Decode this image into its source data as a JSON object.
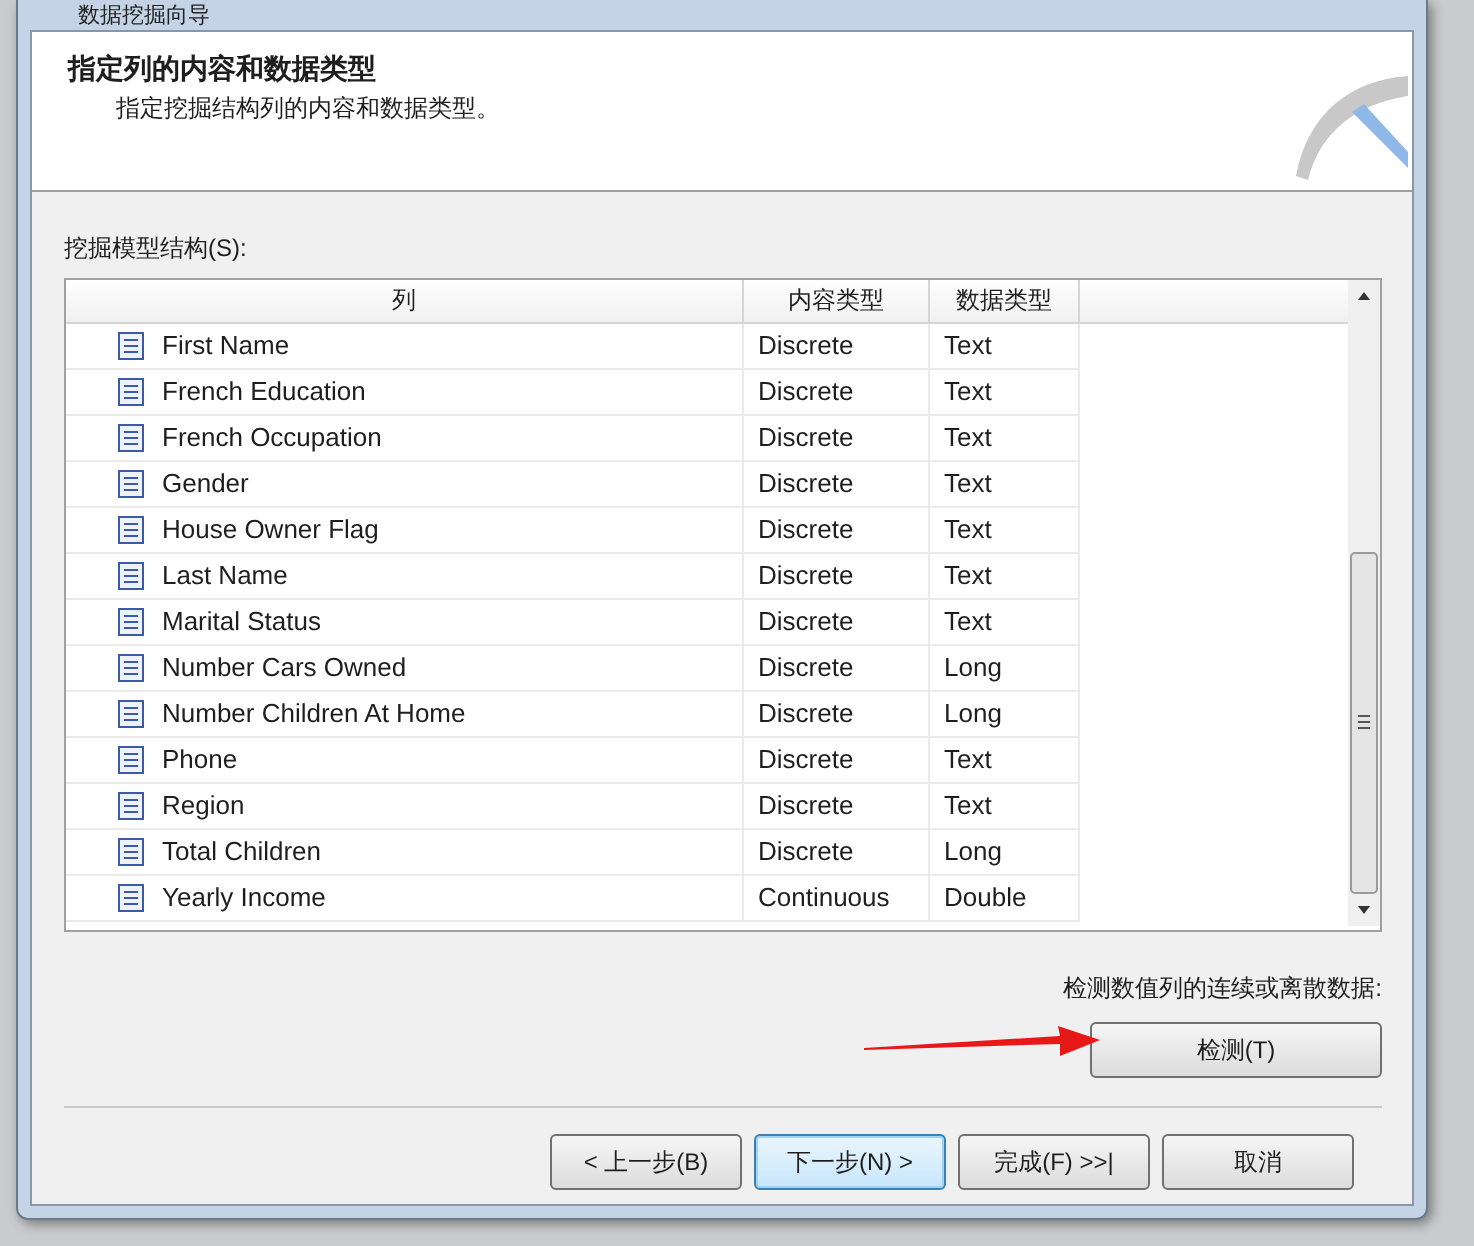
{
  "window": {
    "title": "数据挖掘向导"
  },
  "header": {
    "title": "指定列的内容和数据类型",
    "subtitle": "指定挖掘结构列的内容和数据类型。"
  },
  "structure_label": "挖掘模型结构(S):",
  "table": {
    "columns": [
      "列",
      "内容类型",
      "数据类型"
    ],
    "rows": [
      {
        "name": "First Name",
        "content": "Discrete",
        "type": "Text"
      },
      {
        "name": "French Education",
        "content": "Discrete",
        "type": "Text"
      },
      {
        "name": "French Occupation",
        "content": "Discrete",
        "type": "Text"
      },
      {
        "name": "Gender",
        "content": "Discrete",
        "type": "Text"
      },
      {
        "name": "House Owner Flag",
        "content": "Discrete",
        "type": "Text"
      },
      {
        "name": "Last Name",
        "content": "Discrete",
        "type": "Text"
      },
      {
        "name": "Marital Status",
        "content": "Discrete",
        "type": "Text"
      },
      {
        "name": "Number Cars Owned",
        "content": "Discrete",
        "type": "Long"
      },
      {
        "name": "Number Children At Home",
        "content": "Discrete",
        "type": "Long"
      },
      {
        "name": "Phone",
        "content": "Discrete",
        "type": "Text"
      },
      {
        "name": "Region",
        "content": "Discrete",
        "type": "Text"
      },
      {
        "name": "Total Children",
        "content": "Discrete",
        "type": "Long"
      },
      {
        "name": "Yearly Income",
        "content": "Continuous",
        "type": "Double"
      }
    ]
  },
  "detect": {
    "label": "检测数值列的连续或离散数据:",
    "button": "检测(T)"
  },
  "buttons": [
    {
      "label": "< 上一步(B)",
      "selected": false
    },
    {
      "label": "下一步(N) >",
      "selected": true
    },
    {
      "label": "完成(F) >>|",
      "selected": false
    },
    {
      "label": "取消",
      "selected": false
    }
  ]
}
